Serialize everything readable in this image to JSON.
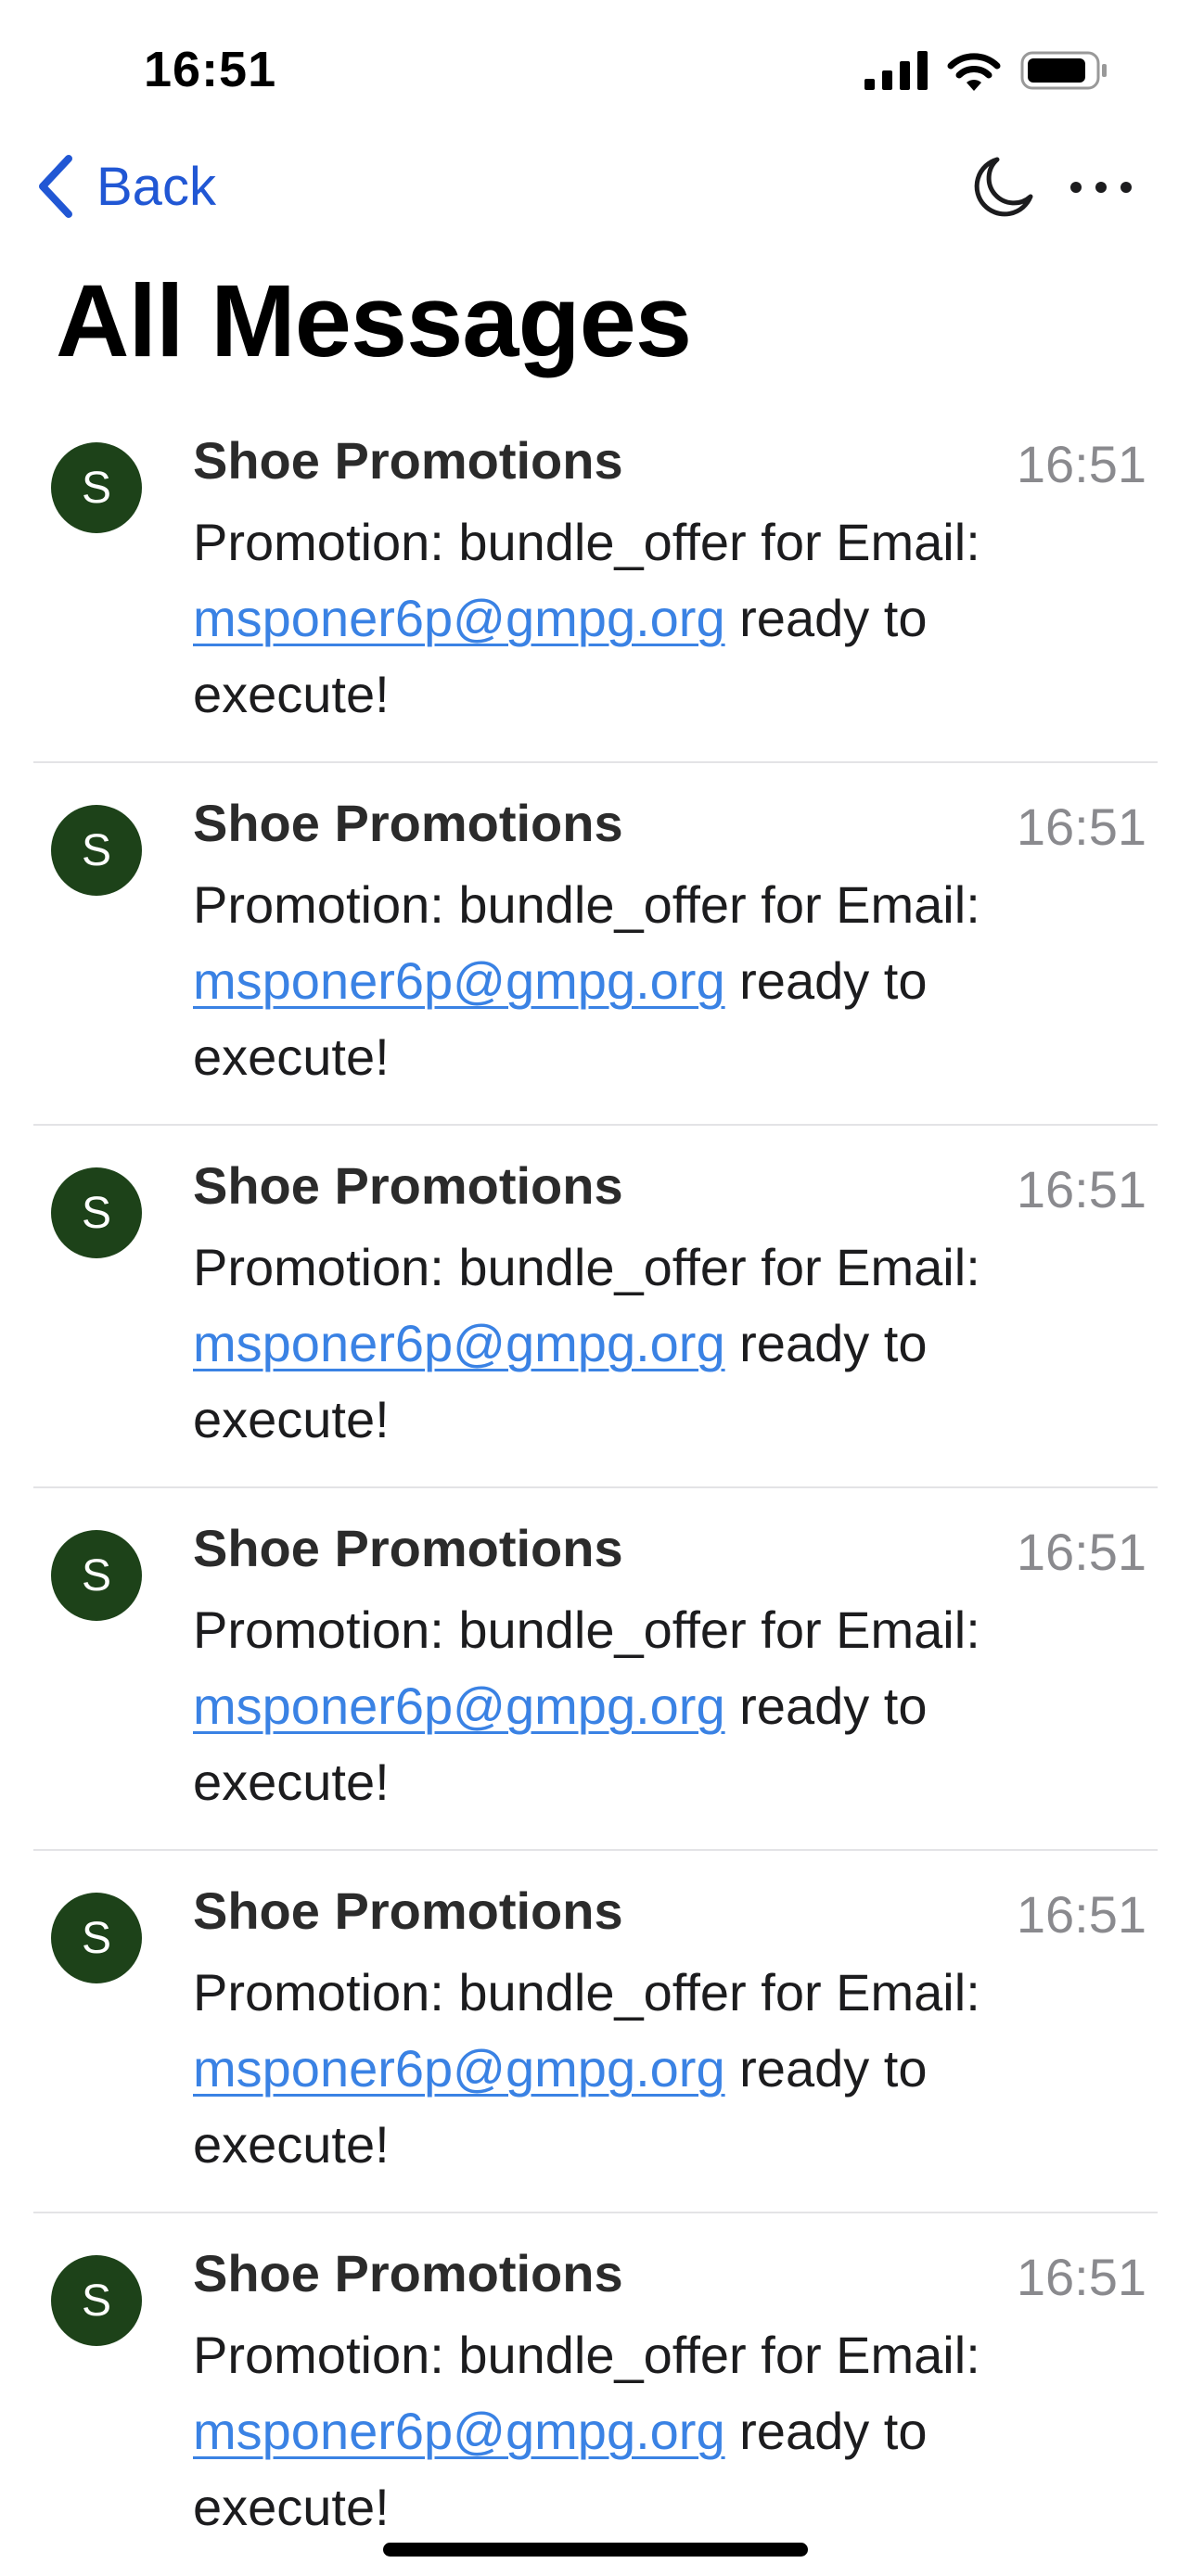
{
  "status_bar": {
    "time": "16:51"
  },
  "nav": {
    "back_label": "Back"
  },
  "page_title": "All Messages",
  "messages": [
    {
      "avatar_letter": "S",
      "sender": "Shoe Promotions",
      "time": "16:51",
      "body_prefix": "Promotion: bundle_offer for Email: ",
      "email": "msponer6p@gmpg.org",
      "body_suffix": " ready to execute!"
    },
    {
      "avatar_letter": "S",
      "sender": "Shoe Promotions",
      "time": "16:51",
      "body_prefix": "Promotion: bundle_offer for Email: ",
      "email": "msponer6p@gmpg.org",
      "body_suffix": " ready to execute!"
    },
    {
      "avatar_letter": "S",
      "sender": "Shoe Promotions",
      "time": "16:51",
      "body_prefix": "Promotion: bundle_offer for Email: ",
      "email": "msponer6p@gmpg.org",
      "body_suffix": " ready to execute!"
    },
    {
      "avatar_letter": "S",
      "sender": "Shoe Promotions",
      "time": "16:51",
      "body_prefix": "Promotion: bundle_offer for Email: ",
      "email": "msponer6p@gmpg.org",
      "body_suffix": " ready to execute!"
    },
    {
      "avatar_letter": "S",
      "sender": "Shoe Promotions",
      "time": "16:51",
      "body_prefix": "Promotion: bundle_offer for Email: ",
      "email": "msponer6p@gmpg.org",
      "body_suffix": " ready to execute!"
    },
    {
      "avatar_letter": "S",
      "sender": "Shoe Promotions",
      "time": "16:51",
      "body_prefix": "Promotion: bundle_offer for Email: ",
      "email": "msponer6p@gmpg.org",
      "body_suffix": " ready to execute!"
    }
  ],
  "icons": {
    "back": "chevron-left-icon",
    "dark_mode": "moon-icon",
    "more": "ellipsis-icon",
    "signal": "cellular-signal-icon",
    "wifi": "wifi-icon",
    "battery": "battery-icon"
  },
  "colors": {
    "accent": "#2157d4",
    "link": "#3a82e4",
    "avatar_bg": "#1d4219",
    "timestamp": "#8a8a8e",
    "divider": "#e3e3e6"
  }
}
